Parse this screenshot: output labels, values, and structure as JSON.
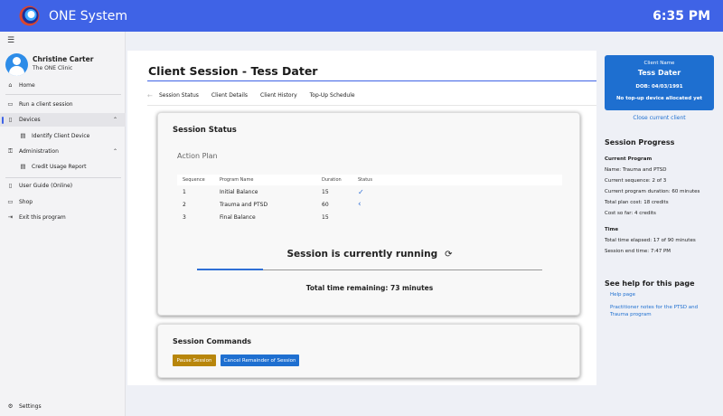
{
  "header": {
    "title": "ONE System",
    "time": "6:35 PM"
  },
  "user": {
    "name": "Christine Carter",
    "org": "The ONE Clinic"
  },
  "nav": {
    "home": "Home",
    "run": "Run a client session",
    "devices": "Devices",
    "identify": "Identify Client Device",
    "admin": "Administration",
    "credit": "Credit Usage Report",
    "guide": "User Guide (Online)",
    "shop": "Shop",
    "exit": "Exit this program",
    "settings": "Settings"
  },
  "page": {
    "title": "Client Session - Tess Dater",
    "tabs": [
      "Session Status",
      "Client Details",
      "Client History",
      "Top-Up Schedule"
    ]
  },
  "status": {
    "title": "Session Status",
    "action_plan": "Action Plan",
    "columns": [
      "Sequence",
      "Program Name",
      "Duration",
      "Status"
    ],
    "rows": [
      {
        "seq": "1",
        "name": "Initial Balance",
        "duration": "15",
        "status": "done"
      },
      {
        "seq": "2",
        "name": "Trauma and PTSD",
        "duration": "60",
        "status": "current"
      },
      {
        "seq": "3",
        "name": "Final Balance",
        "duration": "15",
        "status": ""
      }
    ],
    "running": "Session is currently running",
    "progress": 0.19,
    "remaining": "Total time remaining: 73 minutes"
  },
  "commands": {
    "title": "Session Commands",
    "pause": "Pause Session",
    "cancel": "Cancel Remainder of Session"
  },
  "client": {
    "label": "Client Name",
    "name": "Tess Dater",
    "dob": "DOB: 04/03/1991",
    "device": "No top-up device allocated yet",
    "close": "Close current client"
  },
  "progress_info": {
    "heading": "Session Progress",
    "current_program_heading": "Current Program",
    "name": "Name: Trauma and PTSD",
    "sequence": "Current sequence: 2 of 3",
    "duration": "Current program duration: 60 minutes",
    "plan_cost": "Total plan cost: 18 credits",
    "cost_so_far": "Cost so far: 4 credits",
    "time_heading": "Time",
    "elapsed": "Total time elapsed: 17 of 90 minutes",
    "end_time": "Session end time: 7:47 PM"
  },
  "help": {
    "heading": "See help for this page",
    "page_link": "Help page",
    "notes_link": "Practitioner notes for the PTSD and Trauma program"
  },
  "colors": {
    "accent": "#3f63e6",
    "button_primary": "#1e6fd0",
    "button_pause": "#b8860b"
  }
}
